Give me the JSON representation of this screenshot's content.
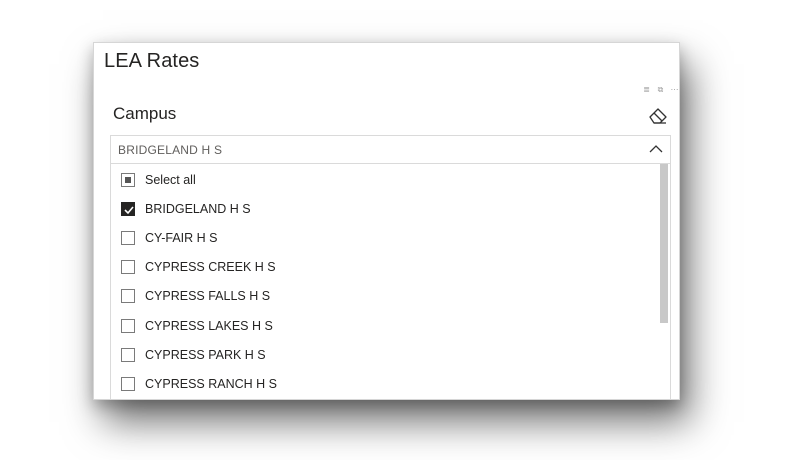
{
  "card": {
    "title": "LEA Rates"
  },
  "visual_header": {
    "icons": [
      "filter-icon",
      "focus-mode-icon",
      "more-options-icon"
    ],
    "filter_glyph": "≣",
    "focus_glyph": "⧉",
    "more_glyph": "⋯"
  },
  "slicer": {
    "header": "Campus",
    "selected_value": "BRIDGELAND H S",
    "items": [
      {
        "label": "Select all",
        "state": "partial"
      },
      {
        "label": "BRIDGELAND H S",
        "state": "checked"
      },
      {
        "label": "CY-FAIR H S",
        "state": "unchecked"
      },
      {
        "label": "CYPRESS CREEK H S",
        "state": "unchecked"
      },
      {
        "label": "CYPRESS FALLS H S",
        "state": "unchecked"
      },
      {
        "label": "CYPRESS LAKES H S",
        "state": "unchecked"
      },
      {
        "label": "CYPRESS PARK H S",
        "state": "unchecked"
      },
      {
        "label": "CYPRESS RANCH H S",
        "state": "unchecked"
      }
    ]
  },
  "colors": {
    "text": "#252423",
    "muted_text": "#605e5c",
    "border": "#dadada",
    "scrollbar": "#c8c8c8"
  }
}
